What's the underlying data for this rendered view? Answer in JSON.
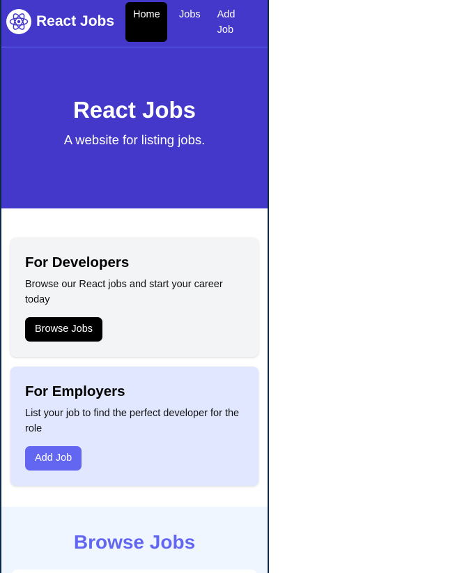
{
  "navbar": {
    "brand": "React Jobs",
    "links": [
      {
        "label": "Home",
        "active": true
      },
      {
        "label": "Jobs",
        "active": false
      },
      {
        "label": "Add Job",
        "active": false
      }
    ]
  },
  "hero": {
    "title": "React Jobs",
    "subtitle": "A website for listing jobs."
  },
  "cards": {
    "developers": {
      "title": "For Developers",
      "text": "Browse our React jobs and start your career today",
      "button": "Browse Jobs"
    },
    "employers": {
      "title": "For Employers",
      "text": "List your job to find the perfect developer for the role",
      "button": "Add Job"
    }
  },
  "browse": {
    "title": "Browse Jobs"
  },
  "colors": {
    "brand": "#4338ca",
    "accent": "#6366f1",
    "developer_card": "#f3f4f6",
    "employer_card": "#e0e7ff",
    "browse_bg": "#eff6ff"
  }
}
